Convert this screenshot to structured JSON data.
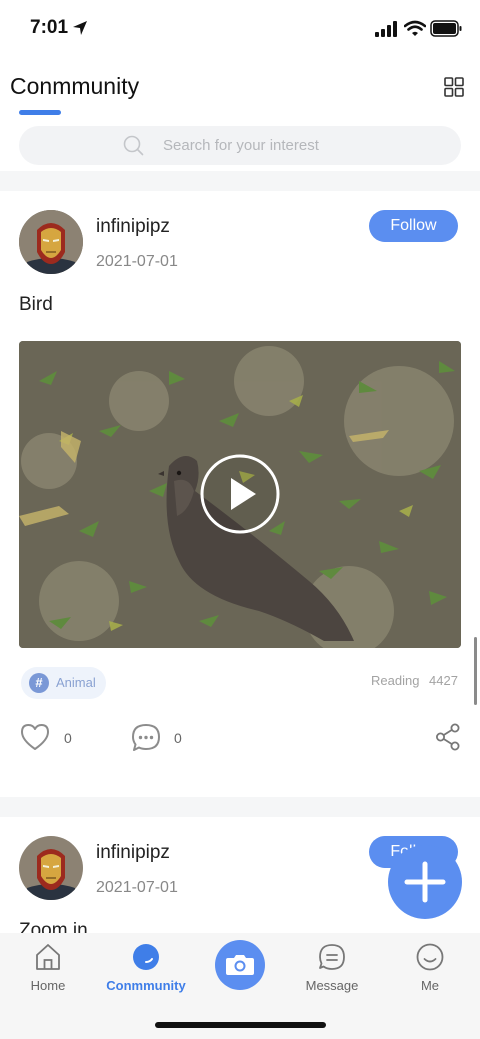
{
  "status_bar": {
    "time": "7:01"
  },
  "header": {
    "title": "Conmmunity"
  },
  "search": {
    "placeholder": "Search for your interest"
  },
  "posts": [
    {
      "username": "infinipipz",
      "date": "2021-07-01",
      "follow_label": "Follow",
      "text": "Bird",
      "tag": "Animal",
      "reading_label": "Reading",
      "reading_count": "4427",
      "likes": "0",
      "comments": "0"
    },
    {
      "username": "infinipipz",
      "date": "2021-07-01",
      "follow_label": "Follow",
      "text": "Zoom in"
    }
  ],
  "tabs": [
    {
      "label": "Home",
      "icon": "home-icon"
    },
    {
      "label": "Conmmunity",
      "icon": "community-icon",
      "active": true
    },
    {
      "label": "",
      "icon": "camera-icon"
    },
    {
      "label": "Message",
      "icon": "message-icon"
    },
    {
      "label": "Me",
      "icon": "smile-icon"
    }
  ],
  "colors": {
    "accent": "#5b8ef0",
    "active_tab": "#3f7ee8"
  }
}
